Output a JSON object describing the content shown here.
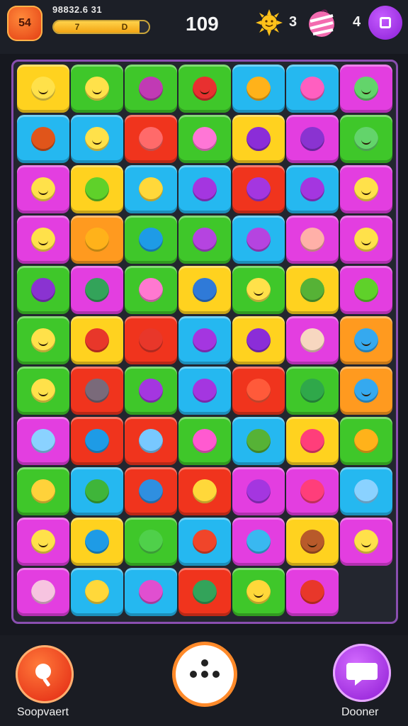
{
  "hud": {
    "level": "54",
    "score_text": "98832.6 31",
    "progress_percent": 90,
    "progress_marks": [
      "7",
      "D"
    ],
    "moves": "109",
    "sun_count": "3",
    "candy_count": "4",
    "menu_icon": "square-icon"
  },
  "colors": {
    "yellow": "#ffd21f",
    "blue": "#25b8f0",
    "green": "#3fc72a",
    "pink": "#e33ee0",
    "red": "#f0341d",
    "orange": "#ff9a1f"
  },
  "board": {
    "rows": [
      [
        {
          "color": "yellow",
          "icon": "smiley-icon"
        },
        {
          "color": "green",
          "icon": "smiley-icon"
        },
        {
          "color": "green",
          "icon": "pickaxe-icon"
        },
        {
          "color": "green",
          "icon": "red-creature-icon"
        },
        {
          "color": "blue",
          "icon": "sun-icon"
        },
        {
          "color": "blue",
          "icon": "pink-ring-icon"
        },
        {
          "color": "pink",
          "icon": "green-creature-icon"
        }
      ],
      [
        {
          "color": "blue",
          "icon": "brick-icon"
        },
        {
          "color": "blue",
          "icon": "smiley-icon"
        },
        {
          "color": "red",
          "icon": "crystal-icon"
        },
        {
          "color": "green",
          "icon": "pink-blob-icon"
        },
        {
          "color": "yellow",
          "icon": "grape-icon"
        },
        {
          "color": "pink",
          "icon": "eggplant-icon"
        },
        {
          "color": "green",
          "icon": "green-creature-icon"
        }
      ],
      [
        {
          "color": "pink",
          "icon": "smiley-icon"
        },
        {
          "color": "yellow",
          "icon": "star-icon"
        },
        {
          "color": "blue",
          "icon": "cube-icon"
        },
        {
          "color": "blue",
          "icon": "crayon-icon"
        },
        {
          "color": "red",
          "icon": "crayon-icon"
        },
        {
          "color": "blue",
          "icon": "crayon-icon"
        },
        {
          "color": "pink",
          "icon": "smiley-icon"
        }
      ],
      [
        {
          "color": "pink",
          "icon": "smiley-icon"
        },
        {
          "color": "orange",
          "icon": "sun-icon"
        },
        {
          "color": "green",
          "icon": "ring-icon"
        },
        {
          "color": "green",
          "icon": "bean-icon"
        },
        {
          "color": "blue",
          "icon": "bean-icon"
        },
        {
          "color": "pink",
          "icon": "box-icon"
        },
        {
          "color": "pink",
          "icon": "smiley-icon"
        }
      ],
      [
        {
          "color": "green",
          "icon": "eggplant-icon"
        },
        {
          "color": "pink",
          "icon": "robot-icon"
        },
        {
          "color": "green",
          "icon": "gift-icon"
        },
        {
          "color": "yellow",
          "icon": "tool-icon"
        },
        {
          "color": "green",
          "icon": "smiley-icon"
        },
        {
          "color": "yellow",
          "icon": "wand-icon"
        },
        {
          "color": "pink",
          "icon": "star-icon"
        }
      ],
      [
        {
          "color": "green",
          "icon": "smiley-icon"
        },
        {
          "color": "yellow",
          "icon": "pepper-icon"
        },
        {
          "color": "red",
          "icon": "strawberry-icon"
        },
        {
          "color": "blue",
          "icon": "crayon-icon"
        },
        {
          "color": "yellow",
          "icon": "grape-icon"
        },
        {
          "color": "pink",
          "icon": "eraser-icon"
        },
        {
          "color": "orange",
          "icon": "blue-smiley-icon"
        }
      ],
      [
        {
          "color": "green",
          "icon": "smiley-icon"
        },
        {
          "color": "red",
          "icon": "bird-icon"
        },
        {
          "color": "green",
          "icon": "crayon-icon"
        },
        {
          "color": "blue",
          "icon": "crayon-icon"
        },
        {
          "color": "red",
          "icon": "snail-icon"
        },
        {
          "color": "green",
          "icon": "leaf-icon"
        },
        {
          "color": "orange",
          "icon": "blue-smiley-icon"
        }
      ],
      [
        {
          "color": "pink",
          "icon": "card-icon"
        },
        {
          "color": "red",
          "icon": "ring-icon"
        },
        {
          "color": "red",
          "icon": "candy-icon"
        },
        {
          "color": "green",
          "icon": "bar-icon"
        },
        {
          "color": "blue",
          "icon": "wand-icon"
        },
        {
          "color": "yellow",
          "icon": "donut-icon"
        },
        {
          "color": "green",
          "icon": "sun-icon"
        }
      ],
      [
        {
          "color": "green",
          "icon": "lightbulb-icon"
        },
        {
          "color": "blue",
          "icon": "turtle-icon"
        },
        {
          "color": "red",
          "icon": "camera-icon"
        },
        {
          "color": "red",
          "icon": "cube-icon"
        },
        {
          "color": "pink",
          "icon": "crayon-icon"
        },
        {
          "color": "pink",
          "icon": "donut-icon"
        },
        {
          "color": "blue",
          "icon": "card-icon"
        }
      ],
      [
        {
          "color": "pink",
          "icon": "smiley-icon"
        },
        {
          "color": "yellow",
          "icon": "ring-icon"
        },
        {
          "color": "green",
          "icon": "dino-icon"
        },
        {
          "color": "blue",
          "icon": "red-blob-icon"
        },
        {
          "color": "pink",
          "icon": "arrow-icon"
        },
        {
          "color": "yellow",
          "icon": "brown-creature-icon"
        },
        {
          "color": "pink",
          "icon": "smiley-icon"
        }
      ],
      [
        {
          "color": "pink",
          "icon": "ham-icon"
        },
        {
          "color": "blue",
          "icon": "duck-icon"
        },
        {
          "color": "blue",
          "icon": "fish-icon"
        },
        {
          "color": "red",
          "icon": "robot-icon"
        },
        {
          "color": "green",
          "icon": "yellow-creature-icon"
        },
        {
          "color": "pink",
          "icon": "brush-icon"
        }
      ]
    ]
  },
  "bottom": {
    "left_label": "Soopvaert",
    "right_label": "Dooner",
    "left_icon": "magnifier-icon",
    "center_icon": "dice-icon",
    "right_icon": "chat-icon"
  }
}
